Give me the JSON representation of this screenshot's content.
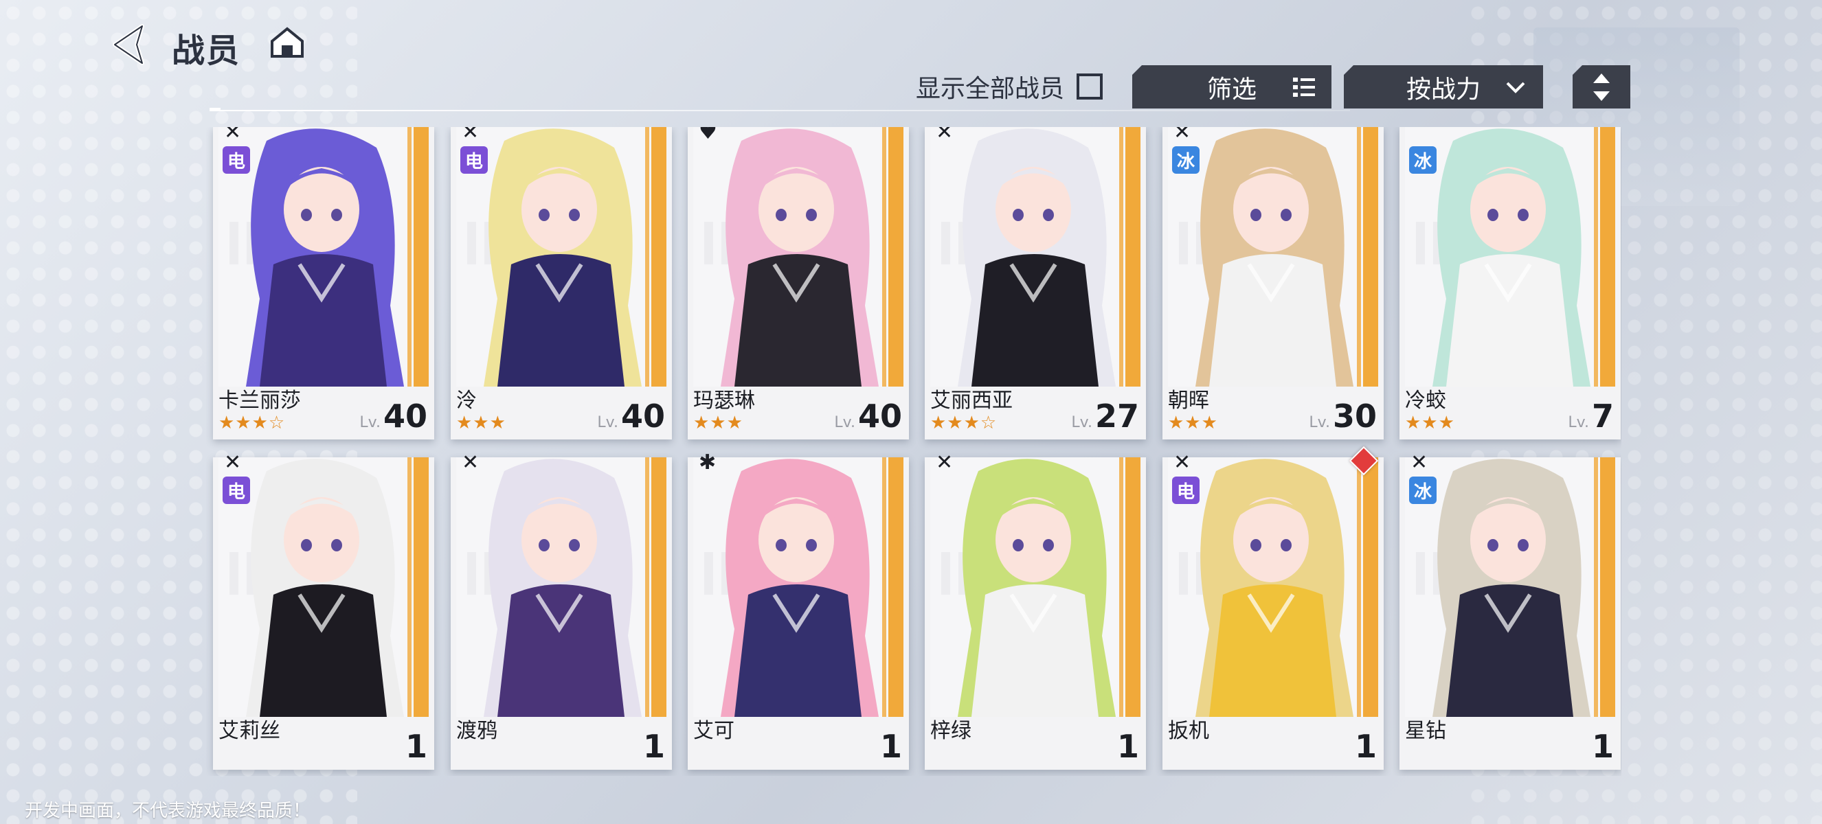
{
  "header": {
    "title": "战员",
    "back_icon": "back-arrow-icon",
    "home_icon": "home-icon"
  },
  "toolbar": {
    "show_all_label": "显示全部战员",
    "show_all_checked": false,
    "filter_label": "筛选",
    "sort_label": "按战力",
    "order_icon": "sort-order-icon"
  },
  "colors": {
    "electric": "#7b4fd6",
    "ice": "#3a86e0",
    "accent_stripe": "#f1a93a",
    "star": "#e38a1e",
    "dark_button": "#3b3f4a"
  },
  "characters": [
    {
      "name": "卡兰丽莎",
      "stars": "★★★☆",
      "lv_prefix": "Lv.",
      "level": "40",
      "element": "电",
      "element_type": "electric",
      "class_icon": "✕",
      "hair": "#6b5cd6",
      "outfit": "#3c2f7e"
    },
    {
      "name": "泠",
      "stars": "★★★",
      "lv_prefix": "Lv.",
      "level": "40",
      "element": "电",
      "element_type": "electric",
      "class_icon": "✕",
      "hair": "#efe39a",
      "outfit": "#2f2a68"
    },
    {
      "name": "玛瑟琳",
      "stars": "★★★",
      "lv_prefix": "Lv.",
      "level": "40",
      "element": "",
      "element_type": "",
      "class_icon": "♥",
      "hair": "#f1b8d4",
      "outfit": "#2a2730"
    },
    {
      "name": "艾丽西亚",
      "stars": "★★★☆",
      "lv_prefix": "Lv.",
      "level": "27",
      "element": "",
      "element_type": "",
      "class_icon": "✕",
      "hair": "#e8e8f0",
      "outfit": "#1f1e26"
    },
    {
      "name": "朝晖",
      "stars": "★★★",
      "lv_prefix": "Lv.",
      "level": "30",
      "element": "冰",
      "element_type": "ice",
      "class_icon": "✕",
      "hair": "#e2c49a",
      "outfit": "#f2f2f2"
    },
    {
      "name": "冷蛟",
      "stars": "★★★",
      "lv_prefix": "Lv.",
      "level": "7",
      "element": "冰",
      "element_type": "ice",
      "class_icon": "",
      "hair": "#bfe6da",
      "outfit": "#f4f4f4"
    },
    {
      "name": "艾莉丝",
      "stars": "",
      "lv_prefix": "",
      "level": "1",
      "element": "电",
      "element_type": "electric",
      "class_icon": "✕",
      "hair": "#eeeeee",
      "outfit": "#1d1b22"
    },
    {
      "name": "渡鸦",
      "stars": "",
      "lv_prefix": "",
      "level": "1",
      "element": "",
      "element_type": "",
      "class_icon": "✕",
      "hair": "#e5e1ee",
      "outfit": "#4a3478"
    },
    {
      "name": "艾可",
      "stars": "",
      "lv_prefix": "",
      "level": "1",
      "element": "",
      "element_type": "",
      "class_icon": "✱",
      "hair": "#f4a8c4",
      "outfit": "#34306e"
    },
    {
      "name": "梓绿",
      "stars": "",
      "lv_prefix": "",
      "level": "1",
      "element": "",
      "element_type": "",
      "class_icon": "✕",
      "hair": "#c9e07a",
      "outfit": "#f2f2f2"
    },
    {
      "name": "扳机",
      "stars": "",
      "lv_prefix": "",
      "level": "1",
      "element": "电",
      "element_type": "electric",
      "class_icon": "✕",
      "hair": "#ecd58a",
      "outfit": "#f0c23a",
      "gem": true
    },
    {
      "name": "星钻",
      "stars": "",
      "lv_prefix": "",
      "level": "1",
      "element": "冰",
      "element_type": "ice",
      "class_icon": "✕",
      "hair": "#d9d2c4",
      "outfit": "#2a2940"
    }
  ],
  "footer": {
    "note": "开发中画面，不代表游戏最终品质！"
  }
}
